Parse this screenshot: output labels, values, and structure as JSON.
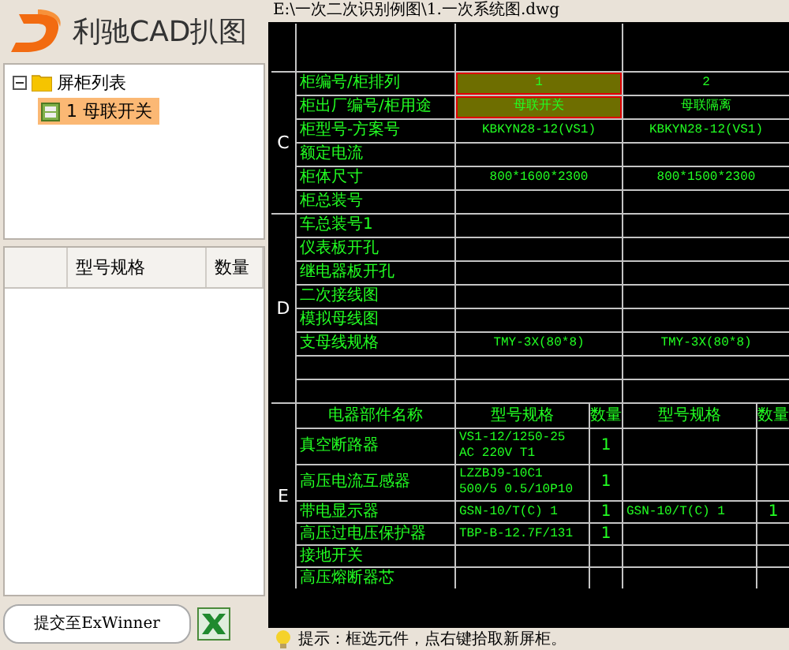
{
  "logo": {
    "text": "利驰CAD扒图"
  },
  "tree": {
    "label": "屏柜列表",
    "expanded": true,
    "children": [
      {
        "label": "1 母联开关",
        "selected": true
      }
    ]
  },
  "parts_list": {
    "columns": [
      "型号规格",
      "数量"
    ]
  },
  "submit_button": "提交至ExWinner",
  "file_path": "E:\\一次二次识别例图\\1.一次系统图.dwg",
  "drawing": {
    "cabinet_columns": [
      {
        "selected": true
      },
      {
        "selected": false
      }
    ],
    "sections": [
      {
        "letter": "C",
        "rows": [
          {
            "label": "柜编号/柜排列",
            "values": [
              "1",
              "2"
            ],
            "kind": "identity"
          },
          {
            "label": "柜出厂编号/柜用途",
            "values": [
              "母联开关",
              "母联隔离"
            ],
            "kind": "identity"
          },
          {
            "label": "柜型号-方案号",
            "values": [
              "KBKYN28-12(VS1)",
              "KBKYN28-12(VS1)"
            ]
          },
          {
            "label": "额定电流"
          },
          {
            "label": "柜体尺寸",
            "values": [
              "800*1600*2300",
              "800*1500*2300"
            ]
          },
          {
            "label": "柜总装号"
          }
        ]
      },
      {
        "letter": "D",
        "rows": [
          {
            "label": "车总装号1"
          },
          {
            "label": "仪表板开孔"
          },
          {
            "label": "继电器板开孔"
          },
          {
            "label": "二次接线图"
          },
          {
            "label": "模拟母线图"
          },
          {
            "label": "支母线规格",
            "values": [
              "TMY-3X(80*8)",
              "TMY-3X(80*8)"
            ]
          },
          {},
          {}
        ]
      }
    ],
    "parts": {
      "letter": "E",
      "columns": [
        "电器部件名称",
        "型号规格",
        "数量",
        "型号规格",
        "数量"
      ],
      "rows": [
        {
          "name": "真空断路器",
          "spec_1": "VS1-12/1250-25 AC 220V T1",
          "qty_1": "1"
        },
        {
          "name": "高压电流互感器",
          "spec_1": "LZZBJ9-10C1 500/5 0.5/10P10",
          "qty_1": "1"
        },
        {
          "name": "带电显示器",
          "spec_1": "GSN-10/T(C) 1",
          "qty_1": "1",
          "spec_2": "GSN-10/T(C) 1",
          "qty_2": "1"
        },
        {
          "name": "高压过电压保护器",
          "spec_1": "TBP-B-12.7F/131",
          "qty_1": "1"
        },
        {
          "name": "接地开关"
        },
        {
          "name": "高压熔断器芯"
        }
      ]
    }
  },
  "status": "提示：框选元件，点右键拾取新屏柜。"
}
